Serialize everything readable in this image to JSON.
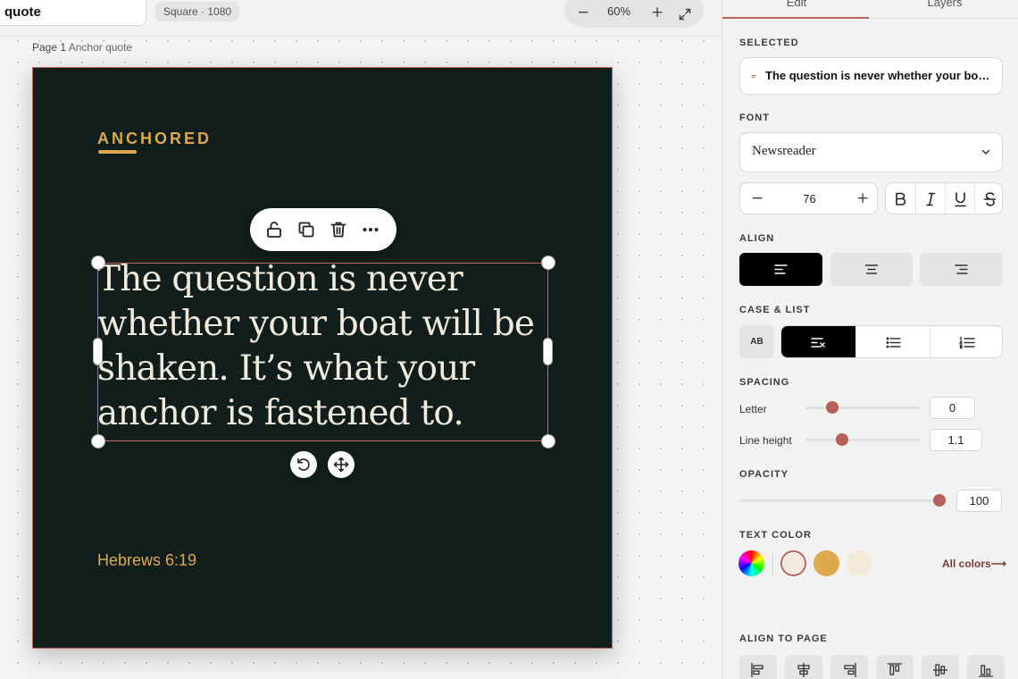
{
  "toolbar": {
    "doc_name": "quote",
    "size_chip": "Square · 1080",
    "zoom_out_label": "−",
    "zoom_value": "60%",
    "zoom_in_label": "+"
  },
  "canvas": {
    "page_number": "Page 1",
    "page_name": "Anchor quote",
    "brand": "ANCHORED",
    "quote": "The question is never whether your boat will be shaken. It’s what your anchor is fastened to.",
    "reference": "Hebrews 6:19"
  },
  "floating_toolbar": {
    "icons": [
      "unlock-icon",
      "duplicate-icon",
      "trash-icon",
      "more-icon"
    ]
  },
  "panel": {
    "tabs": [
      {
        "label": "Edit",
        "active": true
      },
      {
        "label": "Layers",
        "active": false
      }
    ],
    "selected": {
      "label": "SELECTED",
      "text": "The question is never whether your boat will be shaken. It’s what your anchor is fastened to."
    },
    "font": {
      "label": "FONT",
      "name": "Newsreader",
      "size": "76",
      "decrease_label": "−",
      "increase_label": "+"
    },
    "align": {
      "label": "ALIGN",
      "options": [
        "left",
        "center",
        "right"
      ],
      "active": "left"
    },
    "case_list": {
      "label": "CASE & LIST",
      "case_button": "AB",
      "options": [
        "no-list",
        "bullet-list",
        "numbered-list"
      ],
      "active": "no-list"
    },
    "spacing": {
      "label": "SPACING",
      "letter_label": "Letter",
      "letter_value": "0",
      "line_height_label": "Line height",
      "line_height_value": "1.1"
    },
    "opacity": {
      "label": "OPACITY",
      "value": "100"
    },
    "text_color": {
      "label": "TEXT COLOR",
      "swatches": [
        "#f1ebdd",
        "#dea94c",
        "#f4ead9"
      ],
      "selected": "#f1ebdd",
      "all_colors_label": "All colors"
    },
    "align_to_page": {
      "label": "ALIGN TO PAGE",
      "options": [
        "align-left",
        "align-center-horizontal",
        "align-right",
        "align-top",
        "align-middle",
        "align-bottom"
      ]
    }
  },
  "colors": {
    "page_background": "#111e1c",
    "accent_gold": "#dea94c",
    "quote_cream": "#f1ebdd",
    "selection": "#c26a63",
    "slider_knob": "#b65f58"
  }
}
